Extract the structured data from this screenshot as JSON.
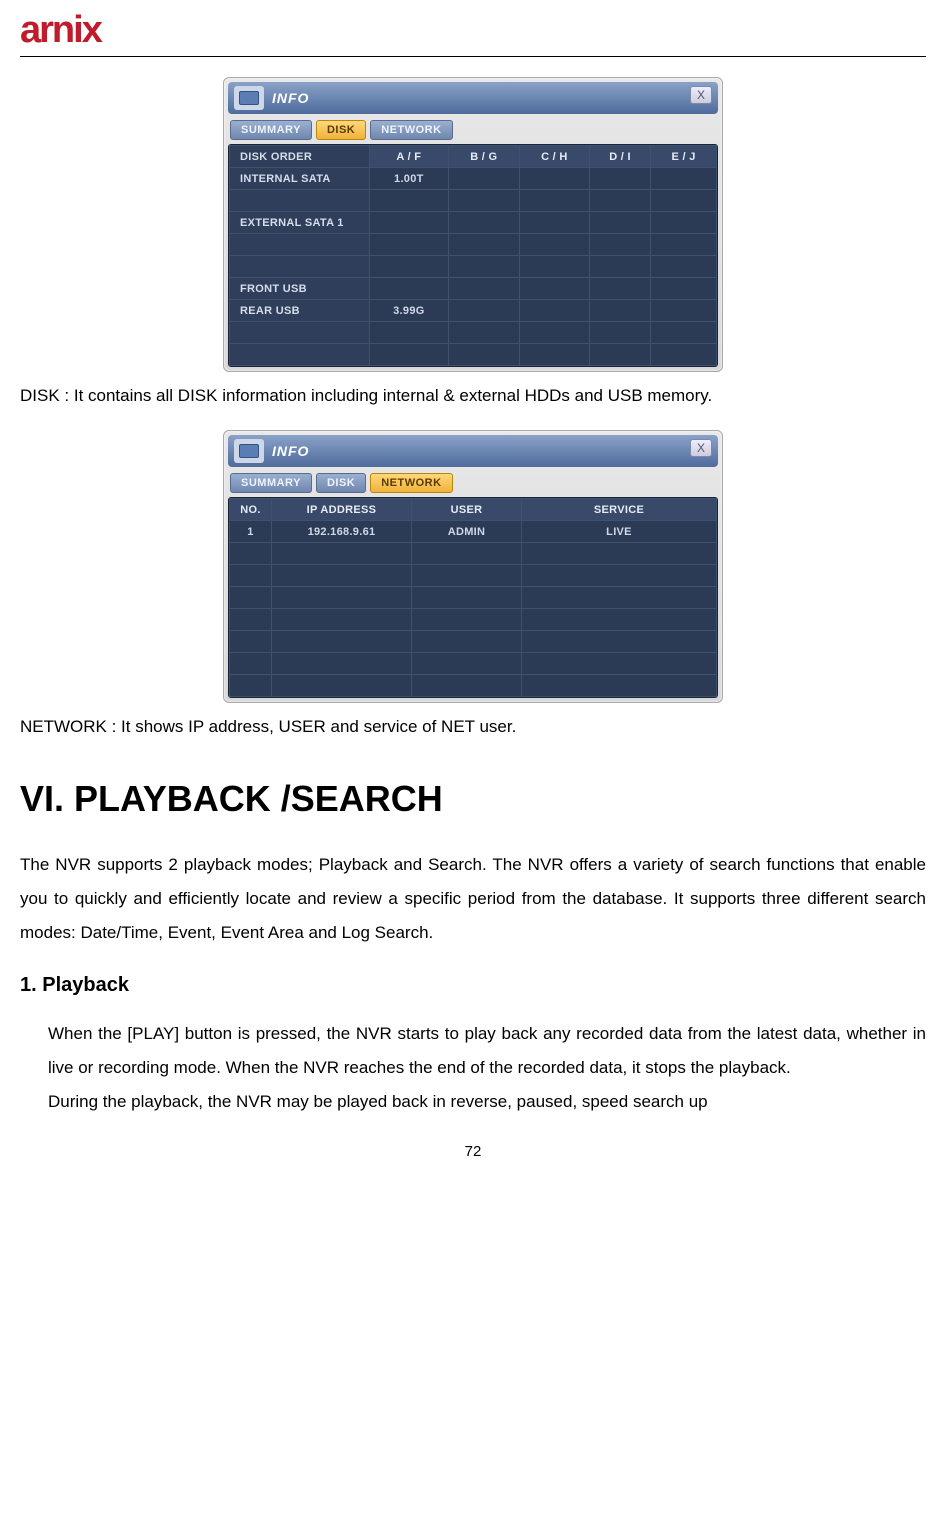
{
  "logo_text": "arnix",
  "info_title": "INFO",
  "close_glyph": "X",
  "tabs": {
    "summary": "SUMMARY",
    "disk": "DISK",
    "network": "NETWORK"
  },
  "disk_table": {
    "headers": [
      "DISK ORDER",
      "A / F",
      "B / G",
      "C / H",
      "D / I",
      "E / J"
    ],
    "rows": [
      {
        "label": "INTERNAL SATA",
        "cells": [
          "1.00T",
          "",
          "",
          "",
          ""
        ]
      },
      {
        "label": "",
        "cells": [
          "",
          "",
          "",
          "",
          ""
        ]
      },
      {
        "label": "EXTERNAL SATA 1",
        "cells": [
          "",
          "",
          "",
          "",
          ""
        ]
      },
      {
        "label": "",
        "cells": [
          "",
          "",
          "",
          "",
          ""
        ]
      },
      {
        "label": "",
        "cells": [
          "",
          "",
          "",
          "",
          ""
        ]
      },
      {
        "label": "FRONT USB",
        "cells": [
          "",
          "",
          "",
          "",
          ""
        ]
      },
      {
        "label": "REAR USB",
        "cells": [
          "3.99G",
          "",
          "",
          "",
          ""
        ]
      },
      {
        "label": "",
        "cells": [
          "",
          "",
          "",
          "",
          ""
        ]
      },
      {
        "label": "",
        "cells": [
          "",
          "",
          "",
          "",
          ""
        ]
      }
    ]
  },
  "caption_disk": "DISK : It contains all DISK information including internal & external HDDs and USB memory.",
  "network_table": {
    "headers": [
      "NO.",
      "IP ADDRESS",
      "USER",
      "SERVICE"
    ],
    "rows": [
      [
        "1",
        "192.168.9.61",
        "ADMIN",
        "LIVE"
      ],
      [
        "",
        "",
        "",
        ""
      ],
      [
        "",
        "",
        "",
        ""
      ],
      [
        "",
        "",
        "",
        ""
      ],
      [
        "",
        "",
        "",
        ""
      ],
      [
        "",
        "",
        "",
        ""
      ],
      [
        "",
        "",
        "",
        ""
      ],
      [
        "",
        "",
        "",
        ""
      ]
    ]
  },
  "caption_network": "NETWORK : It shows IP address, USER and service of NET user.",
  "section_heading": "VI. PLAYBACK /SEARCH",
  "section_body": "The NVR supports 2 playback modes; Playback and Search. The NVR offers a variety of search functions that enable you to quickly and efficiently locate and review a specific period from the database. It supports three different search modes: Date/Time, Event, Event Area and Log Search.",
  "sub_heading": "1. Playback",
  "sub_body1": "When the [PLAY] button is pressed, the NVR starts to play back any recorded data from the latest data, whether in live or recording mode.   When the NVR reaches the end of the recorded data, it stops the playback.",
  "sub_body2": "During the playback, the NVR may be played back in reverse, paused, speed search up",
  "page_number": "72"
}
